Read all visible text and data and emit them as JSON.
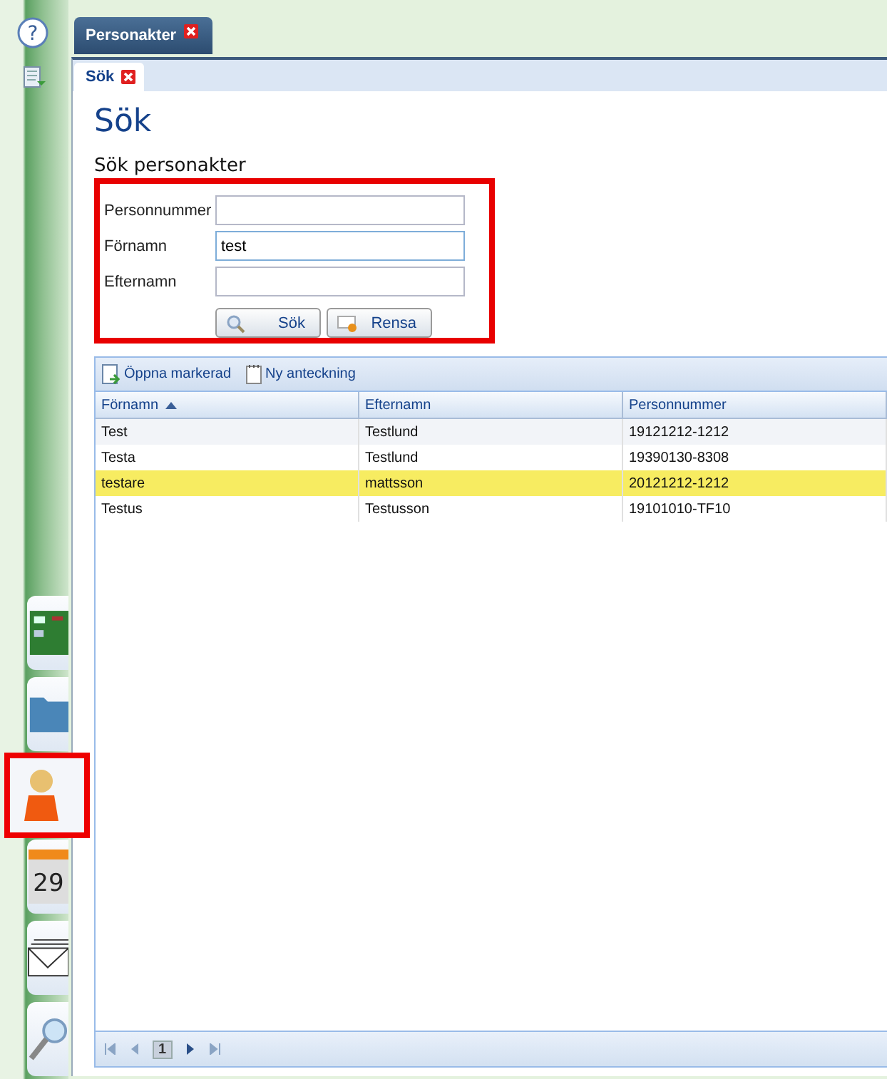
{
  "rail": {
    "help": "?",
    "tiles": [
      {
        "kind": "card",
        "selected": false
      },
      {
        "kind": "folder",
        "selected": false
      },
      {
        "kind": "person",
        "selected": true
      },
      {
        "kind": "calendar",
        "label": "29",
        "selected": false
      },
      {
        "kind": "mail",
        "selected": false
      },
      {
        "kind": "search",
        "selected": false
      }
    ]
  },
  "main_tab": {
    "label": "Personakter",
    "selected": true
  },
  "sub_tab": {
    "label": "Sök",
    "selected": true
  },
  "heading": "Sök",
  "search_form": {
    "title": "Sök personakter",
    "highlighted": true,
    "fields": [
      {
        "label": "Personnummer",
        "focused": false
      },
      {
        "label": "Förnamn",
        "value": "test",
        "focused": true
      },
      {
        "label": "Efternamn",
        "focused": false
      }
    ],
    "buttons": [
      {
        "kind": "search",
        "label": "Sök"
      },
      {
        "kind": "clear",
        "label": "Rensa"
      }
    ]
  },
  "toolbar": [
    {
      "kind": "open",
      "label": "Öppna markerad"
    },
    {
      "kind": "note",
      "label": "Ny anteckning"
    }
  ],
  "table": {
    "columns": [
      {
        "label": "Förnamn",
        "sorted": true
      },
      {
        "label": "Efternamn",
        "sorted": false
      },
      {
        "label": "Personnummer",
        "sorted": false
      }
    ],
    "rows": [
      {
        "cells": [
          "Test",
          "Testlund",
          "19121212-1212"
        ],
        "selected": false
      },
      {
        "cells": [
          "Testa",
          "Testlund",
          "19390130-8308"
        ],
        "selected": false
      },
      {
        "cells": [
          "testare",
          "mattsson",
          "20121212-1212"
        ],
        "selected": true
      },
      {
        "cells": [
          "Testus",
          "Testusson",
          "19101010-TF10"
        ],
        "selected": false
      }
    ]
  },
  "pager": {
    "page": "1"
  }
}
